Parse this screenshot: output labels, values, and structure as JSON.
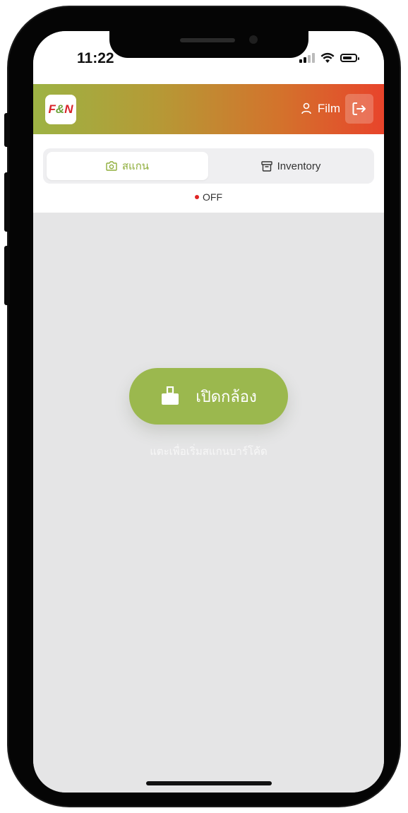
{
  "status_bar": {
    "time": "11:22"
  },
  "header": {
    "logo_left": "F",
    "logo_right": "N",
    "user_name": "Film"
  },
  "tabs": [
    {
      "label": "สแกน",
      "active": true
    },
    {
      "label": "Inventory",
      "active": false
    }
  ],
  "camera_status": {
    "label": "OFF",
    "color": "#e02424"
  },
  "main": {
    "open_camera_label": "เปิดกล้อง",
    "hint": "แตะเพื่อเริ่มสแกนบาร์โค้ด"
  },
  "colors": {
    "accent_green": "#9bb84e",
    "header_gradient_start": "#9db344",
    "header_gradient_end": "#e8442b"
  }
}
